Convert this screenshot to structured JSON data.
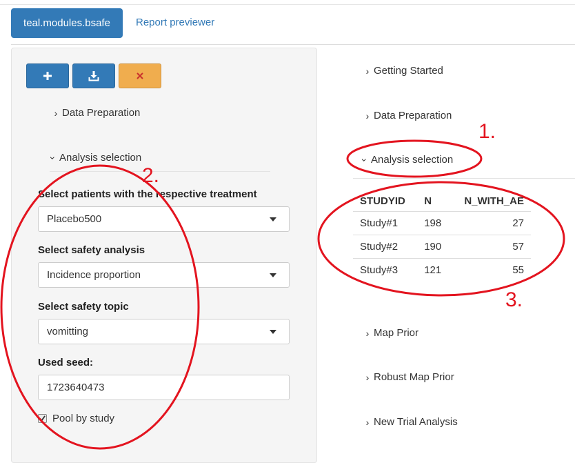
{
  "tabs": {
    "active_label": "teal.modules.bsafe",
    "link_label": "Report previewer"
  },
  "left_panel": {
    "accordion": {
      "data_preparation": "Data Preparation",
      "analysis_selection": "Analysis selection"
    },
    "fields": {
      "treatment_label": "Select patients with the respective treatment",
      "treatment_value": "Placebo500",
      "safety_analysis_label": "Select safety analysis",
      "safety_analysis_value": "Incidence proportion",
      "safety_topic_label": "Select safety topic",
      "safety_topic_value": "vomitting",
      "seed_label": "Used seed:",
      "seed_value": "1723640473",
      "pool_label": "Pool by study"
    }
  },
  "right_panel": {
    "accordion": {
      "getting_started": "Getting Started",
      "data_preparation": "Data Preparation",
      "analysis_selection": "Analysis selection",
      "map_prior": "Map Prior",
      "robust_map_prior": "Robust Map Prior",
      "new_trial_analysis": "New Trial Analysis"
    },
    "table": {
      "headers": [
        "STUDYID",
        "N",
        "N_WITH_AE"
      ],
      "rows": [
        [
          "Study#1",
          "198",
          "27"
        ],
        [
          "Study#2",
          "190",
          "57"
        ],
        [
          "Study#3",
          "121",
          "55"
        ]
      ]
    }
  },
  "annotations": {
    "one": "1.",
    "two": "2.",
    "three": "3."
  },
  "colors": {
    "primary": "#337ab7",
    "warning": "#f0ad4e",
    "annotation_red": "#e3141f"
  },
  "icons": [
    "plus-icon",
    "download-icon",
    "close-icon",
    "chevron-right-icon",
    "chevron-down-icon",
    "checkmark-icon"
  ]
}
